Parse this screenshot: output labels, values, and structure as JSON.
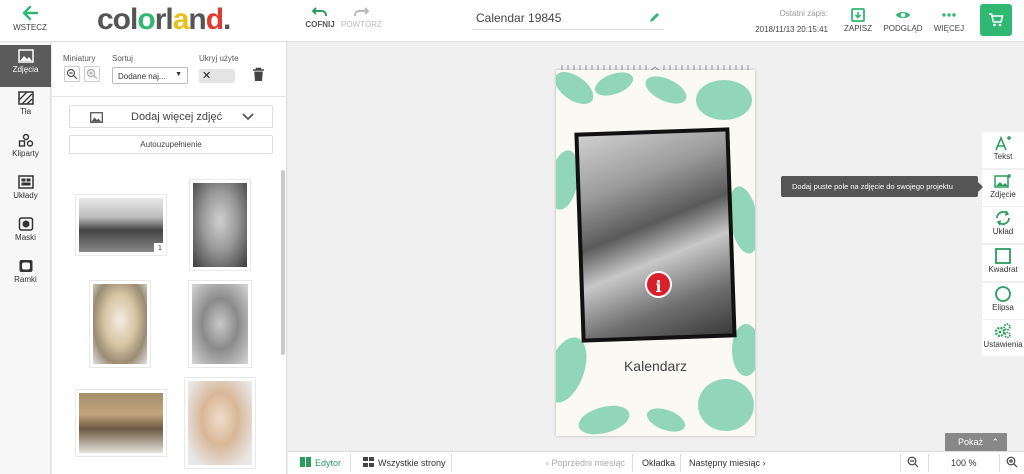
{
  "header": {
    "back_label": "WSTECZ",
    "logo_text": "colorland",
    "undo_label": "COFNIJ",
    "redo_label": "POWTÓRZ",
    "project_title": "Calendar 19845",
    "last_save_label": "Ostatni zapis:",
    "last_save_date": "2018/11/13 20:15:41",
    "save_label": "ZAPISZ",
    "preview_label": "PODGLĄD",
    "more_label": "WIĘCEJ",
    "accent_color": "#2eb872"
  },
  "leftnav": {
    "items": [
      {
        "label": "Zdjęcia",
        "icon": "image-icon"
      },
      {
        "label": "Tła",
        "icon": "pattern-icon"
      },
      {
        "label": "Kliparty",
        "icon": "shapes-icon"
      },
      {
        "label": "Układy",
        "icon": "layout-icon"
      },
      {
        "label": "Maski",
        "icon": "mask-icon"
      },
      {
        "label": "Ramki",
        "icon": "frame-icon"
      }
    ]
  },
  "panel": {
    "thumbnails_label": "Miniatury",
    "sort_label": "Sortuj",
    "sort_value": "Dodane naj...",
    "hide_used_label": "Ukryj użyte",
    "add_more_label": "Dodaj więcej zdjęć",
    "autofill_label": "Autouzupełnienie",
    "photos": [
      {
        "badge": "1"
      },
      {
        "badge": ""
      },
      {
        "badge": ""
      },
      {
        "badge": ""
      },
      {
        "badge": ""
      },
      {
        "badge": ""
      }
    ]
  },
  "canvas": {
    "calendar_text": "Kalendarz",
    "info_glyph": "i"
  },
  "righttools": {
    "items": [
      {
        "label": "Tekst",
        "icon": "text-add-icon"
      },
      {
        "label": "Zdjęcie",
        "icon": "image-add-icon"
      },
      {
        "label": "Układ",
        "icon": "refresh-layout-icon"
      },
      {
        "label": "Kwadrat",
        "icon": "square-icon"
      },
      {
        "label": "Elipsa",
        "icon": "circle-icon"
      },
      {
        "label": "Ustawienia",
        "icon": "settings-icon"
      }
    ],
    "tooltip": "Dodaj puste pole na zdjęcie do swojego projektu"
  },
  "bottom": {
    "show_label": "Pokaż",
    "editor_label": "Edytor",
    "all_pages_label": "Wszystkie strony",
    "prev_month_label": "Poprzedni miesiąc",
    "cover_label": "Okładka",
    "next_month_label": "Następny miesiąc",
    "zoom_value": "100 %"
  }
}
